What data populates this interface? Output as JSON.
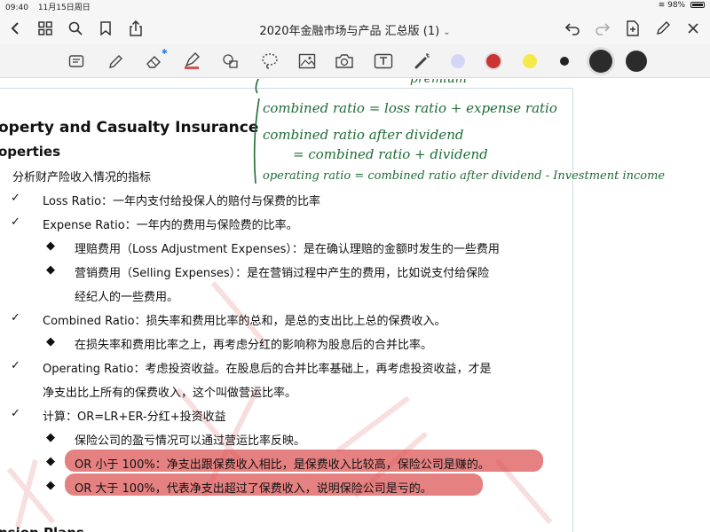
{
  "status_bar": {
    "time": "09:40",
    "date": "11月15日周日",
    "battery": "98%"
  },
  "nav": {
    "title": "2020年金融市场与产品 汇总版 (1)",
    "title_chevron": "⌄",
    "icons": [
      "back-icon",
      "grid-icon",
      "search-icon",
      "bookmark-icon",
      "share-icon",
      "undo-icon",
      "redo-icon",
      "add-page-icon",
      "edit-icon",
      "close-icon"
    ]
  },
  "toolbar": {
    "tools": [
      "document-icon",
      "pen-icon",
      "eraser-icon",
      "highlighter-icon",
      "shapes-icon",
      "lasso-icon",
      "image-icon",
      "camera-icon",
      "text-icon",
      "laser-pointer-icon"
    ],
    "swatches": [
      "#d3d7f5",
      "#cc3333",
      "#f4ea4a",
      "#222222",
      "#2b2b2b",
      "#2b2b2b"
    ]
  },
  "document": {
    "heading1": "operty and Casualty Insurance",
    "heading2": "operties",
    "intro": "分析财产险收入情况的指标",
    "items": [
      {
        "mark": "✓",
        "text": "Loss Ratio：一年内支付给投保人的赔付与保费的比率"
      },
      {
        "mark": "✓",
        "text": "Expense Ratio：一年内的费用与保险费的比率。"
      },
      {
        "mark": "◆",
        "text": "理赔费用（Loss Adjustment Expenses）：是在确认理赔的金额时发生的一些费用"
      },
      {
        "mark": "◆",
        "text": "营销费用（Selling Expenses）：是在营销过程中产生的费用，比如说支付给保险"
      },
      {
        "mark": "",
        "text": "经纪人的一些费用。"
      },
      {
        "mark": "✓",
        "text": "Combined Ratio：损失率和费用比率的总和，是总的支出比上总的保费收入。"
      },
      {
        "mark": "◆",
        "text": "在损失率和费用比率之上，再考虑分红的影响称为股息后的合并比率。"
      },
      {
        "mark": "✓",
        "text": "Operating Ratio：考虑投资收益。在股息后的合并比率基础上，再考虑投资收益，才是"
      },
      {
        "mark": "",
        "text": "净支出比上所有的保费收入，这个叫做营运比率。"
      },
      {
        "mark": "✓",
        "text": "计算：OR=LR+ER-分红+投资收益"
      },
      {
        "mark": "◆",
        "text": "保险公司的盈亏情况可以通过营运比率反映。"
      },
      {
        "mark": "◆",
        "text": "OR 小于 100%：净支出跟保费收入相比，是保费收入比较高，保险公司是赚的。"
      },
      {
        "mark": "◆",
        "text": "OR 大于 100%，代表净支出超过了保费收入，说明保险公司是亏的。"
      }
    ],
    "footer_heading": "nsion Plans"
  },
  "annotations": {
    "line0": "premium",
    "line1": "combined ratio = loss ratio + expense ratio",
    "line2": "combined ratio after dividend",
    "line3": "= combined ratio + dividend",
    "line4": "operating ratio = combined ratio after dividend - Investment income",
    "ink_color": "#1e6b35",
    "highlight_color": "#dc5050"
  }
}
